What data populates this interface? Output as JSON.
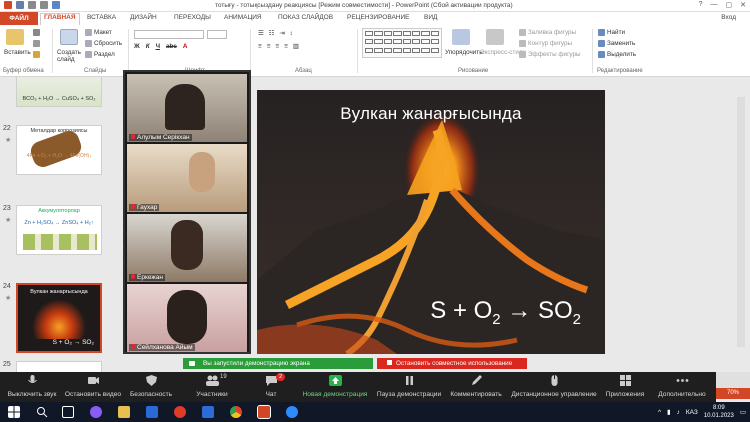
{
  "window": {
    "title": "тотығу - тотықсыздану реакциясы [Режим совместимости] - PowerPoint (Сбой активации продукта)",
    "controls": [
      "?",
      "—",
      "▢",
      "✕"
    ]
  },
  "ribbon_tabs": {
    "file": "ФАЙЛ",
    "home": "ГЛАВНАЯ",
    "insert": "ВСТАВКА",
    "design": "ДИЗАЙН",
    "transitions": "ПЕРЕХОДЫ",
    "animation": "АНИМАЦИЯ",
    "slideshow": "ПОКАЗ СЛАЙДОВ",
    "review": "РЕЦЕНЗИРОВАНИЕ",
    "view": "ВИД",
    "login": "Вход"
  },
  "ribbon": {
    "paste": "Вставить",
    "clipboard_group": "Буфер обмена",
    "create_slide": "Создать слайд",
    "layout": "Макет",
    "reset": "Сбросить",
    "section": "Раздел",
    "slides_group": "Слайды",
    "font_group": "Шрифт",
    "paragraph_group": "Абзац",
    "arrange": "Упорядочить",
    "quick_styles": "Экспресс-стили",
    "fill": "Заливка фигуры",
    "outline": "Контур фигуры",
    "effects": "Эффекты фигуры",
    "drawing_group": "Рисование",
    "find": "Найти",
    "replace": "Заменить",
    "select": "Выделить",
    "editing_group": "Редактирование"
  },
  "thumbnails": [
    {
      "num": "",
      "title": "",
      "formula": "BCO₃ + H₂O → CuSO₄ + SO₂"
    },
    {
      "num": "22",
      "title": "Металдар коррозиясы",
      "formula": "4Fe + O₂ + H₂O → 4Fe(OH)₃"
    },
    {
      "num": "23",
      "title": "Аккумуляторлар",
      "formula": "Zn + H₂SO₄ → ZnSO₄ + H₂↑"
    },
    {
      "num": "24",
      "title": "Вулкан жанарғысында",
      "formula": "S + O₂ → SO₂"
    },
    {
      "num": "25",
      "title": "",
      "formula": ""
    }
  ],
  "slide": {
    "title": "Вулкан жанарғысында",
    "formula_parts": [
      "S + O",
      "2",
      " → SO",
      "2"
    ]
  },
  "participants": [
    {
      "name": "Алулым Серікхан"
    },
    {
      "name": "Гаухар"
    },
    {
      "name": "Еркежан"
    },
    {
      "name": "Сейлханова Айым"
    }
  ],
  "share": {
    "message": "Вы запустили демонстрацию экрана",
    "stop": "Остановить совместное использование"
  },
  "zoom_toolbar": [
    {
      "label": "Выключить звук",
      "icon": "microphone-icon"
    },
    {
      "label": "Остановить видео",
      "icon": "video-camera-icon"
    },
    {
      "label": "Безопасность",
      "icon": "shield-icon"
    },
    {
      "label": "Участники",
      "icon": "participants-icon",
      "badge": "19"
    },
    {
      "label": "Чат",
      "icon": "chat-icon",
      "badge": "2"
    },
    {
      "label": "Новая демонстрация",
      "icon": "share-screen-icon"
    },
    {
      "label": "Пауза демонстрации",
      "icon": "pause-icon"
    },
    {
      "label": "Комментировать",
      "icon": "pen-icon"
    },
    {
      "label": "Дистанционное управление",
      "icon": "mouse-icon"
    },
    {
      "label": "Приложения",
      "icon": "apps-icon"
    },
    {
      "label": "Дополнительно",
      "icon": "more-icon"
    }
  ],
  "statusbar": {
    "zoom": "70%"
  },
  "taskbar": {
    "lang": "КАЗ",
    "time": "8:09",
    "date": "10.01.2023"
  },
  "colors": {
    "accent": "#d24726",
    "share_green": "#2a9d3a",
    "stop_red": "#d9281f",
    "zoom_bar": "#1f1f1f",
    "taskbar": "#101828"
  }
}
